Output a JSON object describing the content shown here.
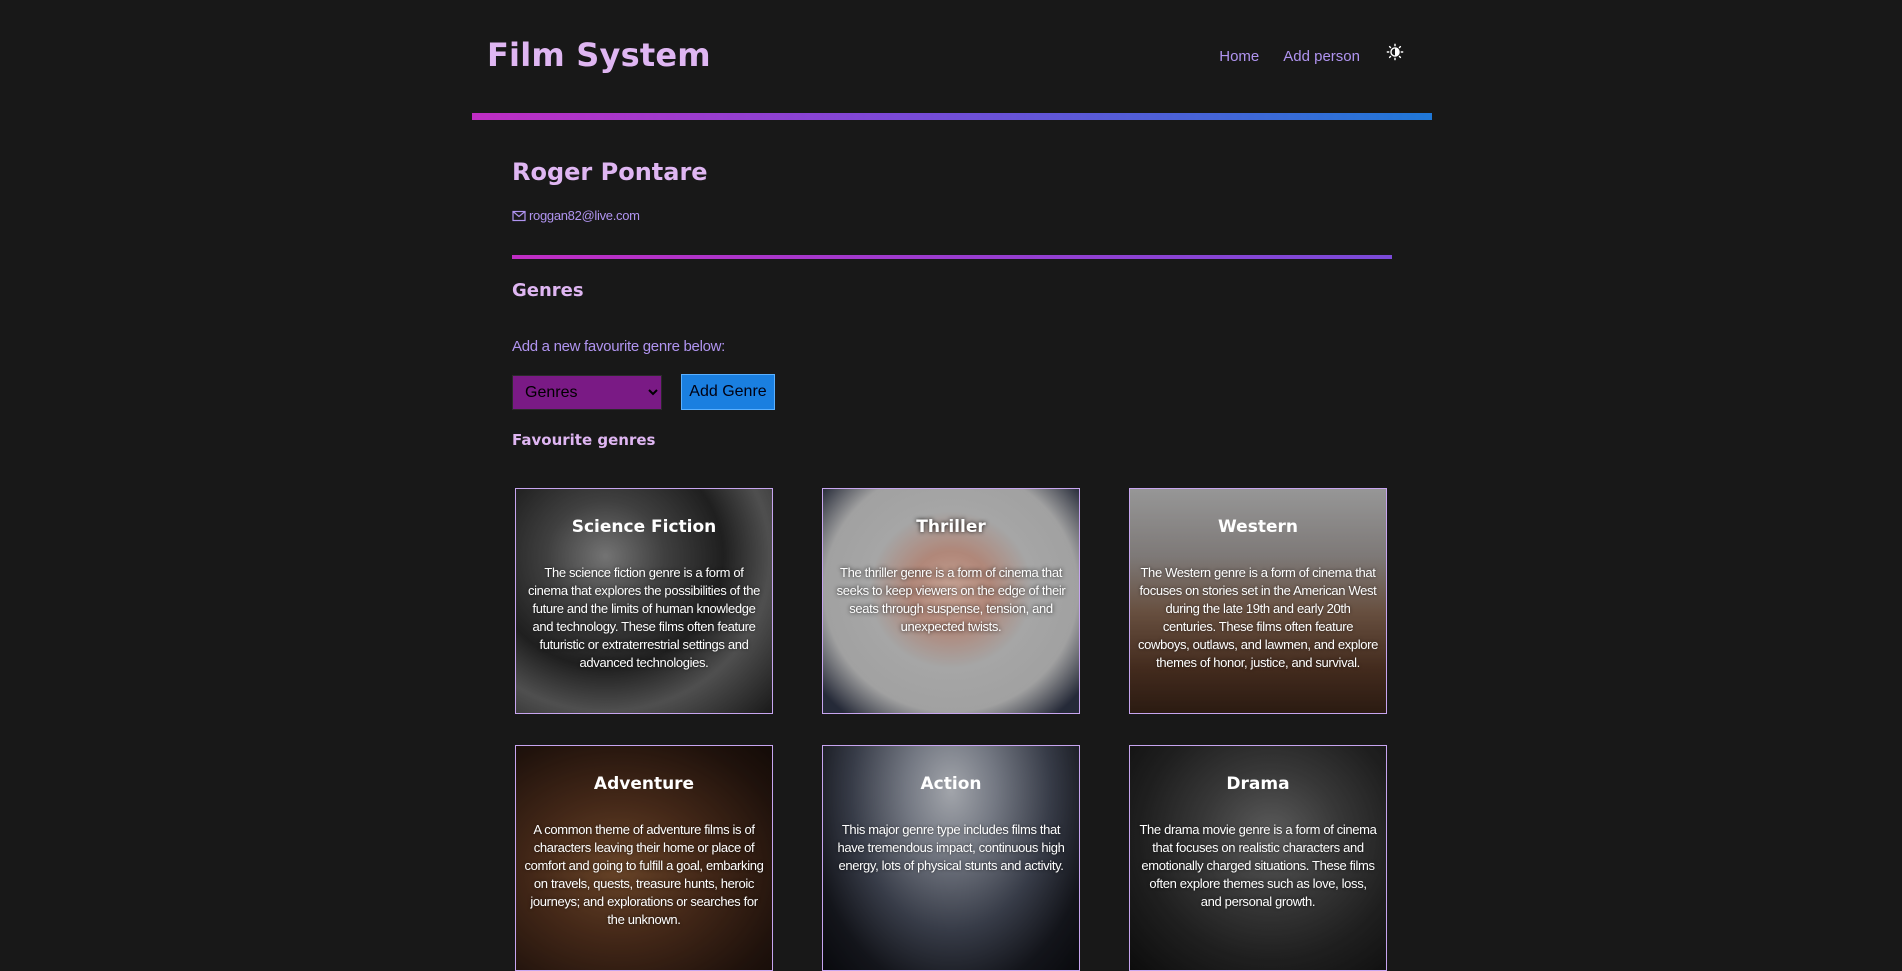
{
  "header": {
    "title": "Film System",
    "nav": {
      "home": "Home",
      "add_person": "Add person"
    },
    "theme_icon": "sun-moon-icon"
  },
  "person": {
    "name": "Roger Pontare",
    "email": "roggan82@live.com",
    "email_icon": "envelope-icon"
  },
  "genres_section": {
    "heading": "Genres",
    "add_label": "Add a new favourite genre below:",
    "select_value": "Genres",
    "add_button": "Add Genre",
    "favourites_heading": "Favourite genres"
  },
  "colors": {
    "background": "#181818",
    "title": "#dfb6f2",
    "link": "#b094f0",
    "gradient_start": "#c02dc4",
    "gradient_end": "#1f78d8",
    "select_bg": "#7a1a85",
    "button_bg": "#1a7fe0"
  },
  "cards": [
    {
      "title": "Science Fiction",
      "description": "The science fiction genre is a form of cinema that explores the possibilities of the future and the limits of human knowledge and technology. These films often feature futuristic or extraterrestrial settings and advanced technologies."
    },
    {
      "title": "Thriller",
      "description": "The thriller genre is a form of cinema that seeks to keep viewers on the edge of their seats through suspense, tension, and unexpected twists."
    },
    {
      "title": "Western",
      "description": "The Western genre is a form of cinema that focuses on stories set in the American West during the late 19th and early 20th centuries. These films often feature cowboys, outlaws, and lawmen, and explore themes of honor, justice, and survival."
    },
    {
      "title": "Adventure",
      "description": "A common theme of adventure films is of characters leaving their home or place of comfort and going to fulfill a goal, embarking on travels, quests, treasure hunts, heroic journeys; and explorations or searches for the unknown."
    },
    {
      "title": "Action",
      "description": "This major genre type includes films that have tremendous impact, continuous high energy, lots of physical stunts and activity."
    },
    {
      "title": "Drama",
      "description": "The drama movie genre is a form of cinema that focuses on realistic characters and emotionally charged situations. These films often explore themes such as love, loss, and personal growth."
    }
  ]
}
